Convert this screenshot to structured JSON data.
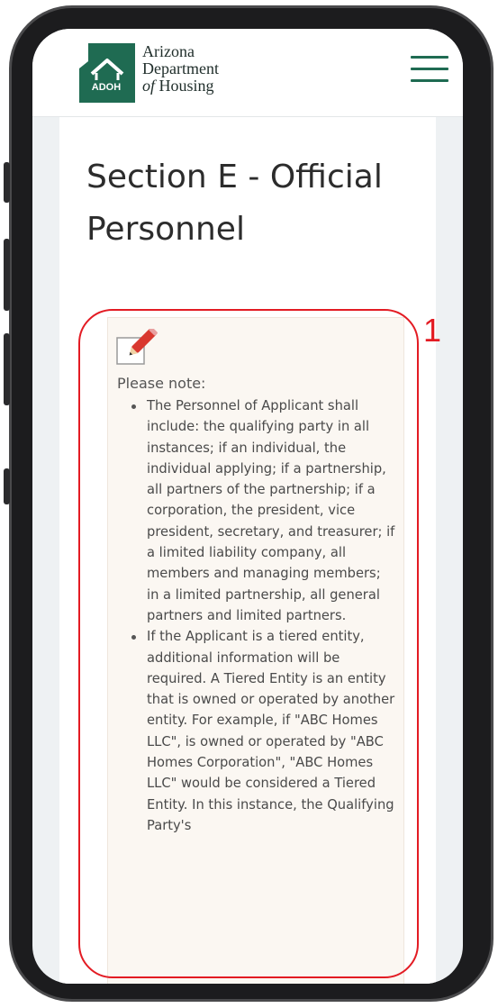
{
  "header": {
    "logo_badge": "ADOH",
    "logo_lines": [
      "Arizona",
      "Department",
      "of",
      "Housing"
    ],
    "menu_icon": "hamburger-menu-icon"
  },
  "page": {
    "title": "Section E - Official Personnel"
  },
  "note": {
    "icon": "pencil-edit-icon",
    "label": "Please note:",
    "items": [
      "The Personnel of Applicant shall include: the qualifying party in all instances; if an individual, the individual applying; if a partnership, all partners of the partnership; if a corporation, the president, vice president, secretary, and treasurer; if a limited liability company, all members and managing members; in a limited partnership, all general partners and limited partners.",
      "If the Applicant is a tiered entity, additional information will be required. A Tiered Entity is an entity that is owned or operated by another entity. For example, if \"ABC Homes LLC\", is owned or operated by \"ABC Homes Corporation\", \"ABC Homes LLC\" would be considered a Tiered Entity. In this instance, the Qualifying Party's"
    ]
  },
  "annotation": {
    "label": "1",
    "color": "#e31b23"
  },
  "colors": {
    "brand_green": "#1f6b52",
    "note_background": "#fbf7f2"
  }
}
